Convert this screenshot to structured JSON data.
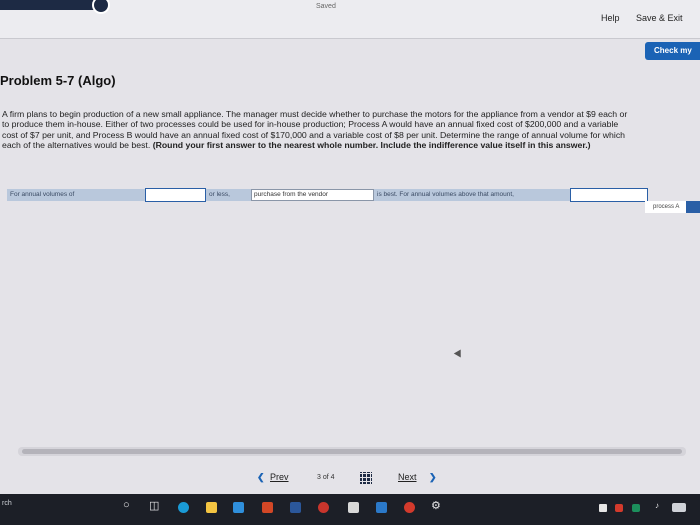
{
  "header": {
    "saved_label": "Saved",
    "help_label": "Help",
    "save_exit_label": "Save & Exit",
    "check_label": "Check my"
  },
  "problem": {
    "title": "Problem 5-7 (Algo)",
    "body": "A firm plans to begin production of a new small appliance. The manager must decide whether to purchase the motors for the appliance from a vendor at $9 each or to produce them in-house. Either of two processes could be used for in-house production; Process A would have an annual fixed cost of $200,000 and a variable cost of $7 per unit, and Process B would have an annual fixed cost of $170,000 and a variable cost of $8 per unit. Determine the range of annual volume for which each of the alternatives would be best.",
    "instruction": "(Round your first answer to the nearest whole number. Include the indifference value itself in this answer.)"
  },
  "answer_row": {
    "label_1": "For annual volumes of",
    "input_1_value": "",
    "label_2": "or less,",
    "select_1_value": "purchase from the vendor",
    "label_3": "is best. For annual volumes above that amount,",
    "input_2_value": "",
    "select_2_value": "process A"
  },
  "pager": {
    "prev_label": "Prev",
    "page_count": "3 of 4",
    "next_label": "Next"
  },
  "taskbar": {
    "search_text": "rch"
  }
}
